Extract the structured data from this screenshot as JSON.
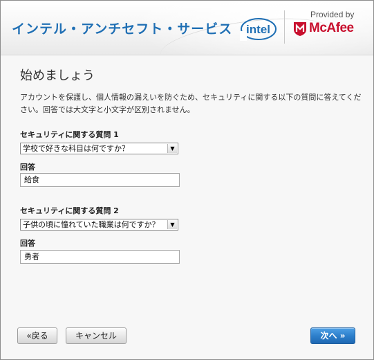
{
  "header": {
    "app_title": "インテル・アンチセフト・サービス",
    "intel_brand": "intel",
    "provided_by": "Provided by",
    "mcafee_brand": "McAfee"
  },
  "page": {
    "title": "始めましょう",
    "intro": "アカウントを保護し、個人情報の漏えいを防ぐため、セキュリティに関する以下の質問に答えてください。回答では大文字と小文字が区別されません。"
  },
  "questions": [
    {
      "label": "セキュリティに関する質問 1",
      "selected": "学校で好きな科目は何ですか？",
      "answer_label": "回答",
      "answer": "給食"
    },
    {
      "label": "セキュリティに関する質問 2",
      "selected": "子供の頃に憧れていた職業は何ですか？",
      "answer_label": "回答",
      "answer": "勇者"
    }
  ],
  "buttons": {
    "back": "«戻る",
    "cancel": "キャンセル",
    "next": "次へ »"
  },
  "colors": {
    "title_blue": "#1f6fb4",
    "mcafee_red": "#c8102e",
    "primary_button": "#2d7fcb"
  }
}
